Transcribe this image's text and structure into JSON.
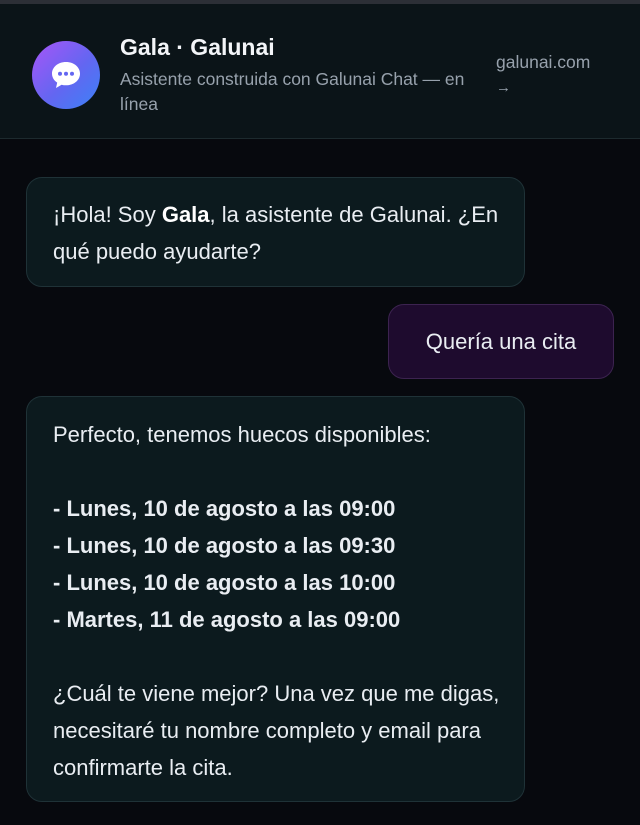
{
  "header": {
    "avatar_icon": "chat-bubble-icon",
    "title": "Gala · Galunai",
    "subtitle": "Asistente construida con Galunai Chat — en línea",
    "site_link_label": "galunai.com",
    "site_link_arrow": "→"
  },
  "messages": {
    "greeting": {
      "prefix": "¡Hola! Soy ",
      "name": "Gala",
      "suffix": ", la asistente de Galunai. ¿En qué puedo ayudarte?"
    },
    "user_message": "Quería una cita",
    "reply": {
      "intro": "Perfecto, tenemos huecos disponibles:",
      "slots": [
        "- Lunes, 10 de agosto a las 09:00",
        "- Lunes, 10 de agosto a las 09:30",
        "- Lunes, 10 de agosto a las 10:00",
        "- Martes, 11 de agosto a las 09:00"
      ],
      "closing": "¿Cuál te viene mejor? Una vez que me digas, necesitaré tu nombre completo y email para confirmarte la cita."
    }
  },
  "colors": {
    "background": "#07090e",
    "header_bg": "#0b1418",
    "bot_bubble": "#0c1a1e",
    "user_bubble": "#1e0b2e",
    "avatar_gradient": [
      "#a855f7",
      "#6366f1",
      "#3b82f6"
    ]
  }
}
